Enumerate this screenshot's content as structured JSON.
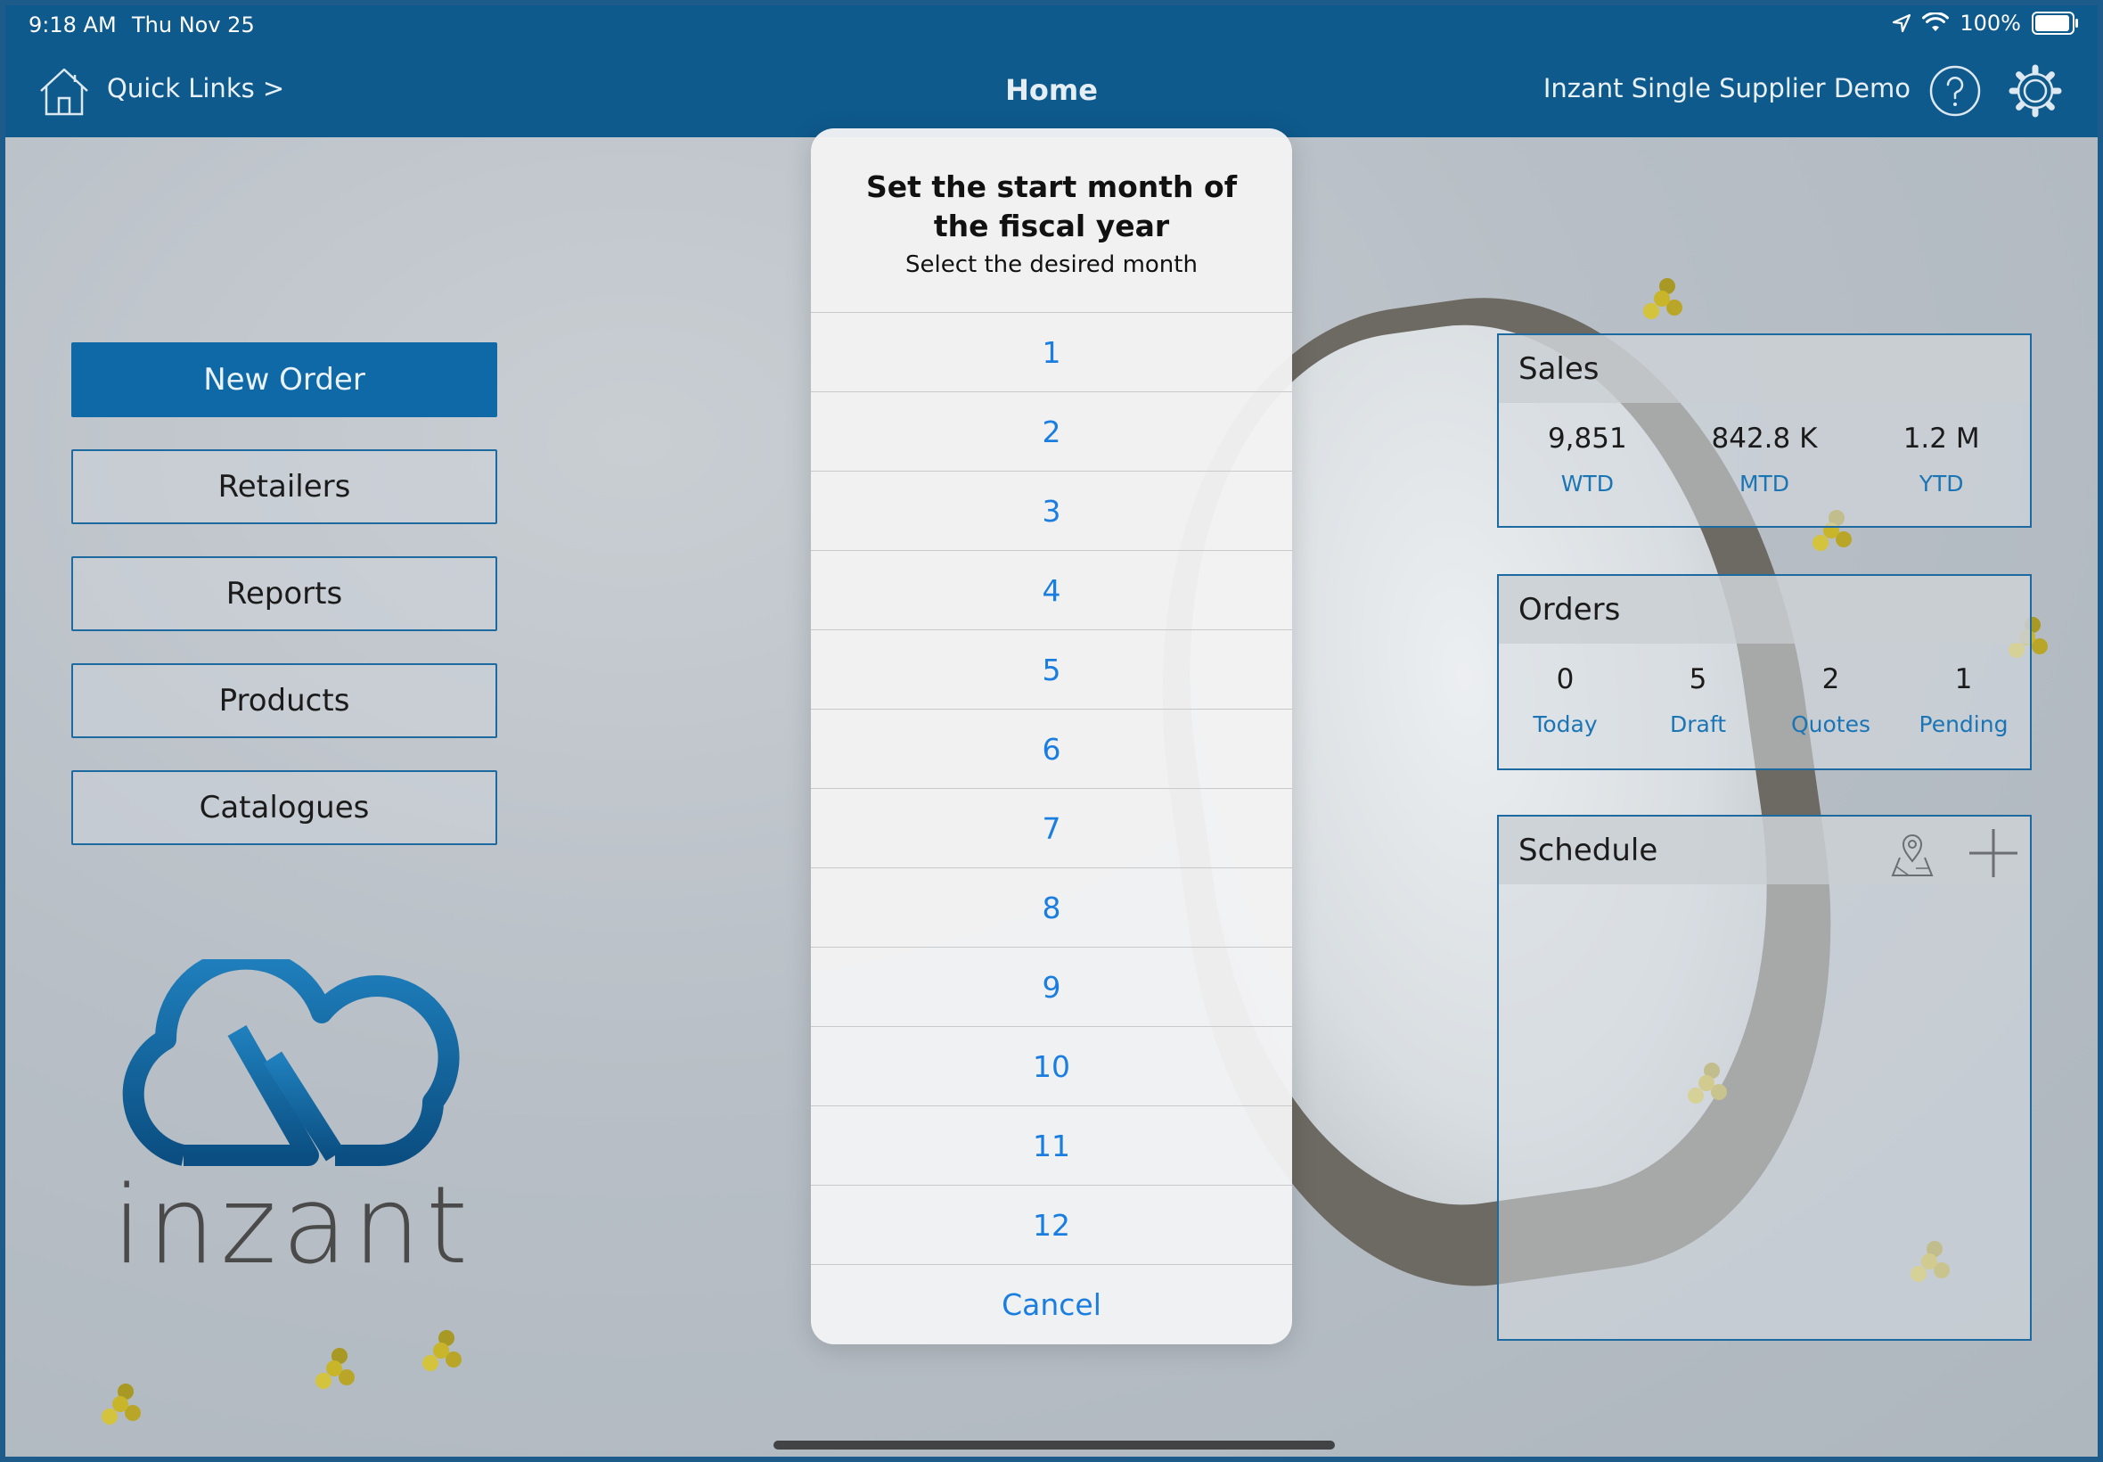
{
  "status_bar": {
    "time": "9:18 AM",
    "date": "Thu Nov 25",
    "battery": "100%",
    "icons": [
      "location-arrow-icon",
      "wifi-icon",
      "battery-icon"
    ]
  },
  "nav": {
    "quick_links": "Quick Links >",
    "title": "Home",
    "supplier": "Inzant Single Supplier Demo",
    "icons": [
      "home-icon",
      "help-icon",
      "gear-icon"
    ]
  },
  "menu": {
    "new_order": "New Order",
    "retailers": "Retailers",
    "reports": "Reports",
    "products": "Products",
    "catalogues": "Catalogues"
  },
  "logo": {
    "text": "inzant"
  },
  "sales": {
    "title": "Sales",
    "stats": [
      {
        "value": "9,851",
        "label": "WTD"
      },
      {
        "value": "842.8 K",
        "label": "MTD"
      },
      {
        "value": "1.2 M",
        "label": "YTD"
      }
    ]
  },
  "orders": {
    "title": "Orders",
    "stats": [
      {
        "value": "0",
        "label": "Today"
      },
      {
        "value": "5",
        "label": "Draft"
      },
      {
        "value": "2",
        "label": "Quotes"
      },
      {
        "value": "1",
        "label": "Pending"
      }
    ]
  },
  "schedule": {
    "title": "Schedule",
    "icons": [
      "map-pin-icon",
      "plus-icon"
    ]
  },
  "dialog": {
    "title": "Set the start month of the fiscal year",
    "subtitle": "Select the desired month",
    "options": [
      "1",
      "2",
      "3",
      "4",
      "5",
      "6",
      "7",
      "8",
      "9",
      "10",
      "11",
      "12"
    ],
    "cancel": "Cancel"
  },
  "colors": {
    "header": "#0e5a8c",
    "accent": "#0f69a6",
    "link": "#1a7ee0"
  }
}
